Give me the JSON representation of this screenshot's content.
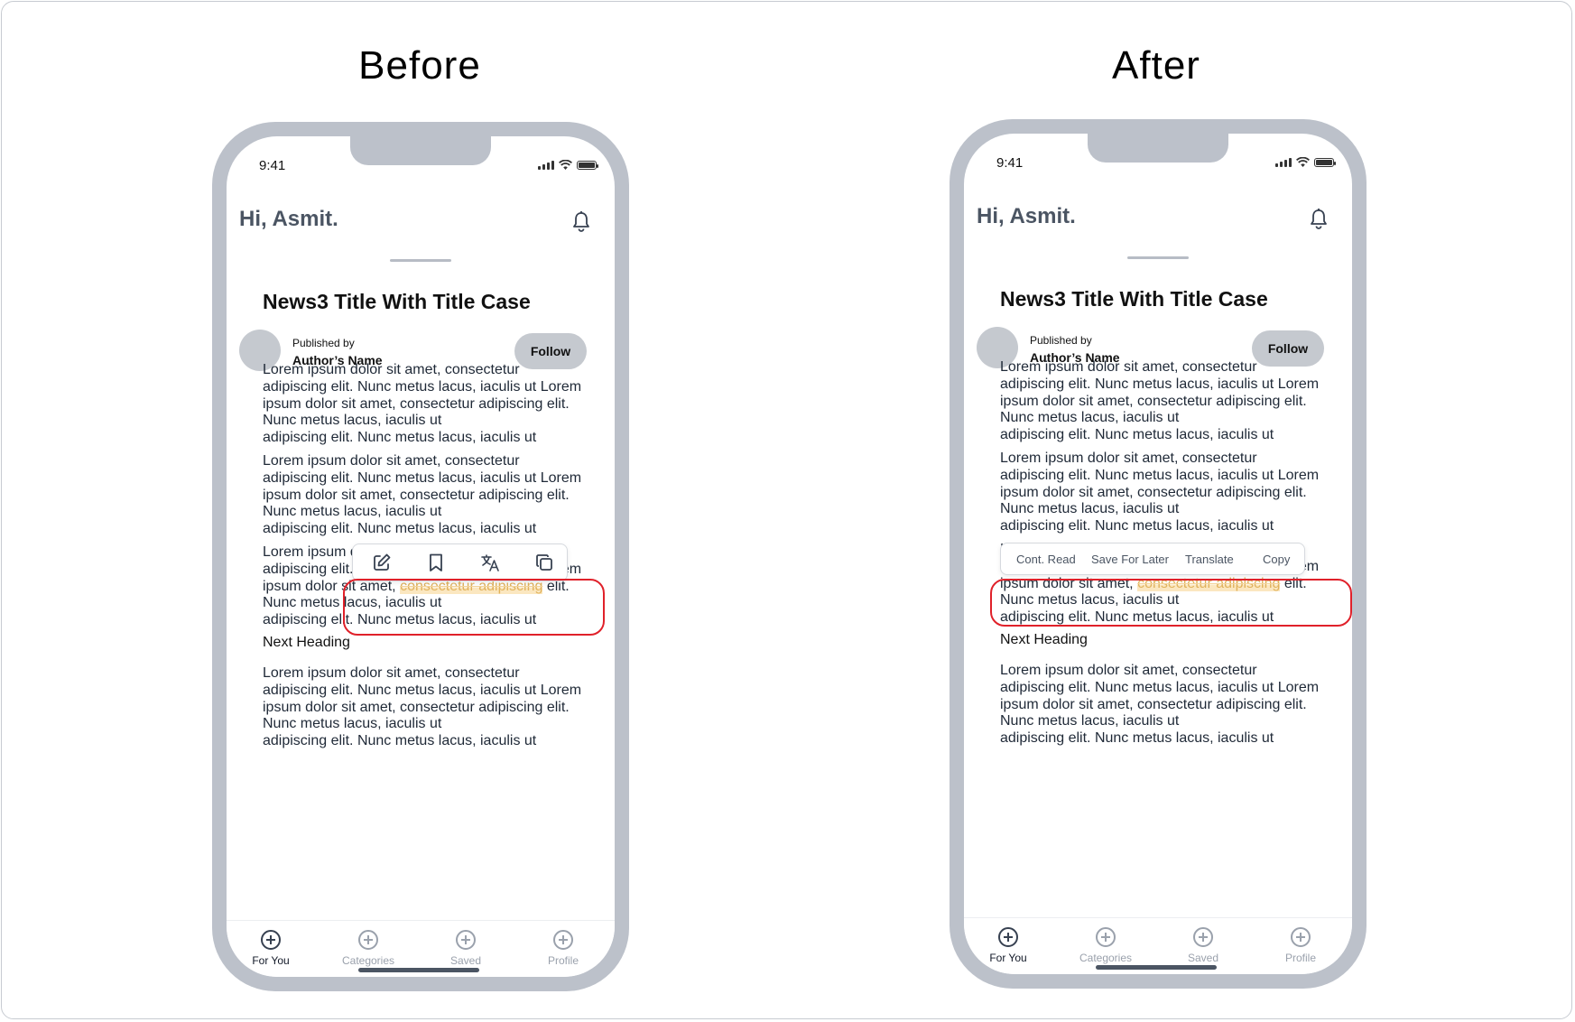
{
  "labels": {
    "before": "Before",
    "after": "After"
  },
  "phone": {
    "time": "9:41",
    "greeting": "Hi, Asmit.",
    "news_title": "News3 Title With Title Case",
    "published_by": "Published by",
    "author_name": "Author’s Name",
    "follow_label": "Follow",
    "paragraph": "Lorem ipsum dolor sit amet, consectetur\nadipiscing elit. Nunc metus lacus, iaculis ut Lorem\nipsum dolor sit amet, consectetur adipiscing elit.\nNunc metus lacus, iaculis ut\nadipiscing elit. Nunc metus lacus, iaculis ut",
    "sel_line1": "Lorem ipsum dolor sit amet, consectetur",
    "sel_line2": "adipiscing elit. Nunc metus lacus, iaculis ut Lorem",
    "sel_line3_pre": "ipsum dolor sit amet, ",
    "sel_highlight": "consectetur adipiscing",
    "sel_line3_post": " elit.",
    "sel_line4": "Nunc metus lacus, iaculis ut",
    "sel_line5": "adipiscing elit. Nunc metus lacus, iaculis ut",
    "next_heading": "Next Heading",
    "tabs": [
      "For You",
      "Categories",
      "Saved",
      "Profile"
    ],
    "active_tab": "For You"
  },
  "before_toolbar": {
    "icons": [
      "edit-icon",
      "bookmark-icon",
      "translate-icon",
      "copy-icon"
    ]
  },
  "after_toolbar": {
    "actions": [
      "Cont. Read",
      "Save For Later",
      "Translate",
      "Copy"
    ]
  },
  "colors": {
    "frame": "#bcc1ca",
    "highlight_text": "#e0b25c",
    "callout": "#e0212a"
  }
}
